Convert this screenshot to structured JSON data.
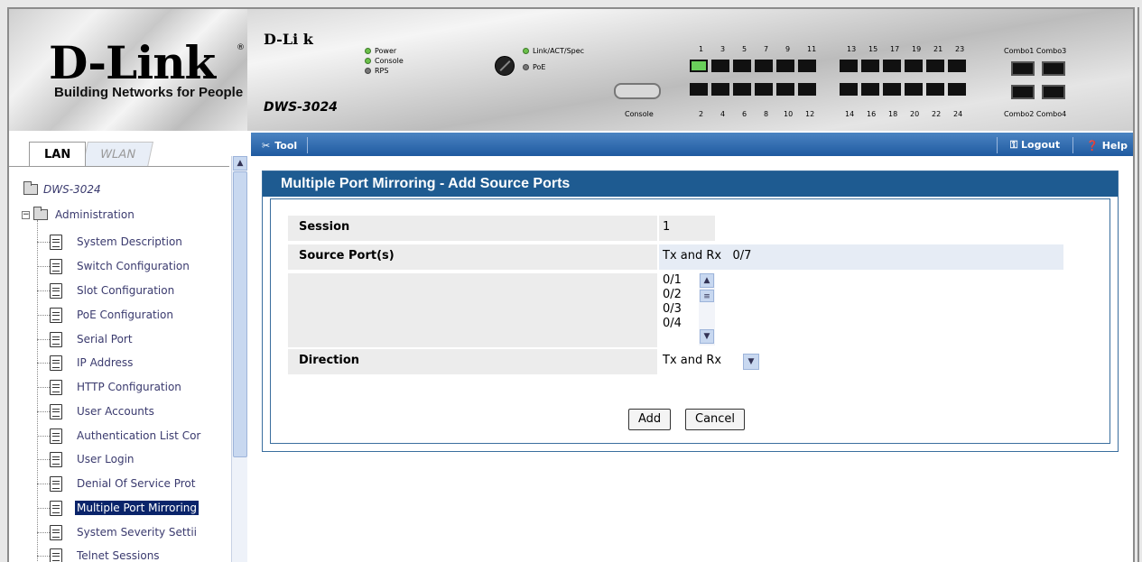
{
  "brand": {
    "name": "D-Link",
    "registered": "®",
    "tagline": "Building Networks for People"
  },
  "device": {
    "mini_brand": "D-Li   k",
    "model": "DWS-3024",
    "leds_left": [
      "Power",
      "Console",
      "RPS"
    ],
    "leds_right": [
      "Link/ACT/Spec",
      "PoE"
    ],
    "console_label": "Console",
    "ports_top_labels": [
      "1",
      "3",
      "5",
      "7",
      "9",
      "11",
      "13",
      "15",
      "17",
      "19",
      "21",
      "23"
    ],
    "ports_bottom_labels": [
      "2",
      "4",
      "6",
      "8",
      "10",
      "12",
      "14",
      "16",
      "18",
      "20",
      "22",
      "24"
    ],
    "combo_top": "Combo1 Combo3",
    "combo_bottom": "Combo2 Combo4"
  },
  "toolbar": {
    "tool": "Tool",
    "logout": "Logout",
    "help": "Help"
  },
  "tabs": {
    "lan": "LAN",
    "wlan": "WLAN"
  },
  "tree": {
    "root": "DWS-3024",
    "folder": "Administration",
    "items": [
      "System Description",
      "Switch Configuration",
      "Slot Configuration",
      "PoE Configuration",
      "Serial Port",
      "IP Address",
      "HTTP Configuration",
      "User Accounts",
      "Authentication List Cor",
      "User Login",
      "Denial Of Service Prot",
      "Multiple Port Mirroring",
      "System Severity Settii",
      "Telnet Sessions"
    ],
    "selected_index": 11
  },
  "form": {
    "title": "Multiple Port Mirroring - Add Source Ports",
    "session_label": "Session",
    "session_value": "1",
    "source_label": "Source Port(s)",
    "source_value": "Tx and Rx   0/7",
    "port_options": [
      "0/1",
      "0/2",
      "0/3",
      "0/4"
    ],
    "direction_label": "Direction",
    "direction_value": "Tx and Rx",
    "add_button": "Add",
    "cancel_button": "Cancel"
  },
  "colors": {
    "toolbar": "#1f5aa0",
    "panel_title": "#1e5b91",
    "selection": "#0a246a"
  }
}
